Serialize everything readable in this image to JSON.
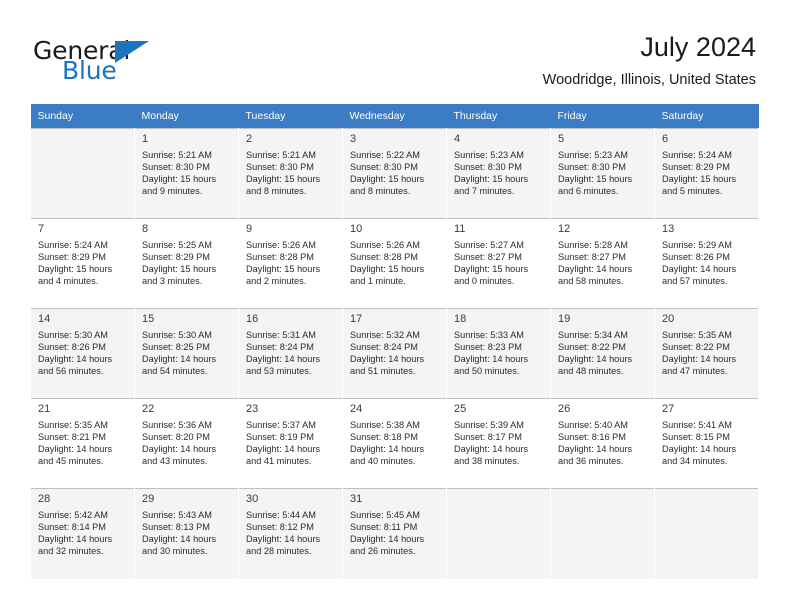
{
  "brand": {
    "name_part1": "General",
    "name_part2": "Blue",
    "logo_icon": "triangle-icon"
  },
  "header": {
    "title": "July 2024",
    "subtitle": "Woodridge, Illinois, United States"
  },
  "calendar": {
    "weekday_headers": [
      "Sunday",
      "Monday",
      "Tuesday",
      "Wednesday",
      "Thursday",
      "Friday",
      "Saturday"
    ],
    "header_bg": "#3b7dc4",
    "alt_row_bg": "#f4f4f4",
    "weeks": [
      [
        {
          "day": "",
          "line1": "",
          "line2": "",
          "line3": "",
          "line4": ""
        },
        {
          "day": "1",
          "line1": "Sunrise: 5:21 AM",
          "line2": "Sunset: 8:30 PM",
          "line3": "Daylight: 15 hours",
          "line4": "and 9 minutes."
        },
        {
          "day": "2",
          "line1": "Sunrise: 5:21 AM",
          "line2": "Sunset: 8:30 PM",
          "line3": "Daylight: 15 hours",
          "line4": "and 8 minutes."
        },
        {
          "day": "3",
          "line1": "Sunrise: 5:22 AM",
          "line2": "Sunset: 8:30 PM",
          "line3": "Daylight: 15 hours",
          "line4": "and 8 minutes."
        },
        {
          "day": "4",
          "line1": "Sunrise: 5:23 AM",
          "line2": "Sunset: 8:30 PM",
          "line3": "Daylight: 15 hours",
          "line4": "and 7 minutes."
        },
        {
          "day": "5",
          "line1": "Sunrise: 5:23 AM",
          "line2": "Sunset: 8:30 PM",
          "line3": "Daylight: 15 hours",
          "line4": "and 6 minutes."
        },
        {
          "day": "6",
          "line1": "Sunrise: 5:24 AM",
          "line2": "Sunset: 8:29 PM",
          "line3": "Daylight: 15 hours",
          "line4": "and 5 minutes."
        }
      ],
      [
        {
          "day": "7",
          "line1": "Sunrise: 5:24 AM",
          "line2": "Sunset: 8:29 PM",
          "line3": "Daylight: 15 hours",
          "line4": "and 4 minutes."
        },
        {
          "day": "8",
          "line1": "Sunrise: 5:25 AM",
          "line2": "Sunset: 8:29 PM",
          "line3": "Daylight: 15 hours",
          "line4": "and 3 minutes."
        },
        {
          "day": "9",
          "line1": "Sunrise: 5:26 AM",
          "line2": "Sunset: 8:28 PM",
          "line3": "Daylight: 15 hours",
          "line4": "and 2 minutes."
        },
        {
          "day": "10",
          "line1": "Sunrise: 5:26 AM",
          "line2": "Sunset: 8:28 PM",
          "line3": "Daylight: 15 hours",
          "line4": "and 1 minute."
        },
        {
          "day": "11",
          "line1": "Sunrise: 5:27 AM",
          "line2": "Sunset: 8:27 PM",
          "line3": "Daylight: 15 hours",
          "line4": "and 0 minutes."
        },
        {
          "day": "12",
          "line1": "Sunrise: 5:28 AM",
          "line2": "Sunset: 8:27 PM",
          "line3": "Daylight: 14 hours",
          "line4": "and 58 minutes."
        },
        {
          "day": "13",
          "line1": "Sunrise: 5:29 AM",
          "line2": "Sunset: 8:26 PM",
          "line3": "Daylight: 14 hours",
          "line4": "and 57 minutes."
        }
      ],
      [
        {
          "day": "14",
          "line1": "Sunrise: 5:30 AM",
          "line2": "Sunset: 8:26 PM",
          "line3": "Daylight: 14 hours",
          "line4": "and 56 minutes."
        },
        {
          "day": "15",
          "line1": "Sunrise: 5:30 AM",
          "line2": "Sunset: 8:25 PM",
          "line3": "Daylight: 14 hours",
          "line4": "and 54 minutes."
        },
        {
          "day": "16",
          "line1": "Sunrise: 5:31 AM",
          "line2": "Sunset: 8:24 PM",
          "line3": "Daylight: 14 hours",
          "line4": "and 53 minutes."
        },
        {
          "day": "17",
          "line1": "Sunrise: 5:32 AM",
          "line2": "Sunset: 8:24 PM",
          "line3": "Daylight: 14 hours",
          "line4": "and 51 minutes."
        },
        {
          "day": "18",
          "line1": "Sunrise: 5:33 AM",
          "line2": "Sunset: 8:23 PM",
          "line3": "Daylight: 14 hours",
          "line4": "and 50 minutes."
        },
        {
          "day": "19",
          "line1": "Sunrise: 5:34 AM",
          "line2": "Sunset: 8:22 PM",
          "line3": "Daylight: 14 hours",
          "line4": "and 48 minutes."
        },
        {
          "day": "20",
          "line1": "Sunrise: 5:35 AM",
          "line2": "Sunset: 8:22 PM",
          "line3": "Daylight: 14 hours",
          "line4": "and 47 minutes."
        }
      ],
      [
        {
          "day": "21",
          "line1": "Sunrise: 5:35 AM",
          "line2": "Sunset: 8:21 PM",
          "line3": "Daylight: 14 hours",
          "line4": "and 45 minutes."
        },
        {
          "day": "22",
          "line1": "Sunrise: 5:36 AM",
          "line2": "Sunset: 8:20 PM",
          "line3": "Daylight: 14 hours",
          "line4": "and 43 minutes."
        },
        {
          "day": "23",
          "line1": "Sunrise: 5:37 AM",
          "line2": "Sunset: 8:19 PM",
          "line3": "Daylight: 14 hours",
          "line4": "and 41 minutes."
        },
        {
          "day": "24",
          "line1": "Sunrise: 5:38 AM",
          "line2": "Sunset: 8:18 PM",
          "line3": "Daylight: 14 hours",
          "line4": "and 40 minutes."
        },
        {
          "day": "25",
          "line1": "Sunrise: 5:39 AM",
          "line2": "Sunset: 8:17 PM",
          "line3": "Daylight: 14 hours",
          "line4": "and 38 minutes."
        },
        {
          "day": "26",
          "line1": "Sunrise: 5:40 AM",
          "line2": "Sunset: 8:16 PM",
          "line3": "Daylight: 14 hours",
          "line4": "and 36 minutes."
        },
        {
          "day": "27",
          "line1": "Sunrise: 5:41 AM",
          "line2": "Sunset: 8:15 PM",
          "line3": "Daylight: 14 hours",
          "line4": "and 34 minutes."
        }
      ],
      [
        {
          "day": "28",
          "line1": "Sunrise: 5:42 AM",
          "line2": "Sunset: 8:14 PM",
          "line3": "Daylight: 14 hours",
          "line4": "and 32 minutes."
        },
        {
          "day": "29",
          "line1": "Sunrise: 5:43 AM",
          "line2": "Sunset: 8:13 PM",
          "line3": "Daylight: 14 hours",
          "line4": "and 30 minutes."
        },
        {
          "day": "30",
          "line1": "Sunrise: 5:44 AM",
          "line2": "Sunset: 8:12 PM",
          "line3": "Daylight: 14 hours",
          "line4": "and 28 minutes."
        },
        {
          "day": "31",
          "line1": "Sunrise: 5:45 AM",
          "line2": "Sunset: 8:11 PM",
          "line3": "Daylight: 14 hours",
          "line4": "and 26 minutes."
        },
        {
          "day": "",
          "line1": "",
          "line2": "",
          "line3": "",
          "line4": ""
        },
        {
          "day": "",
          "line1": "",
          "line2": "",
          "line3": "",
          "line4": ""
        },
        {
          "day": "",
          "line1": "",
          "line2": "",
          "line3": "",
          "line4": ""
        }
      ]
    ]
  }
}
